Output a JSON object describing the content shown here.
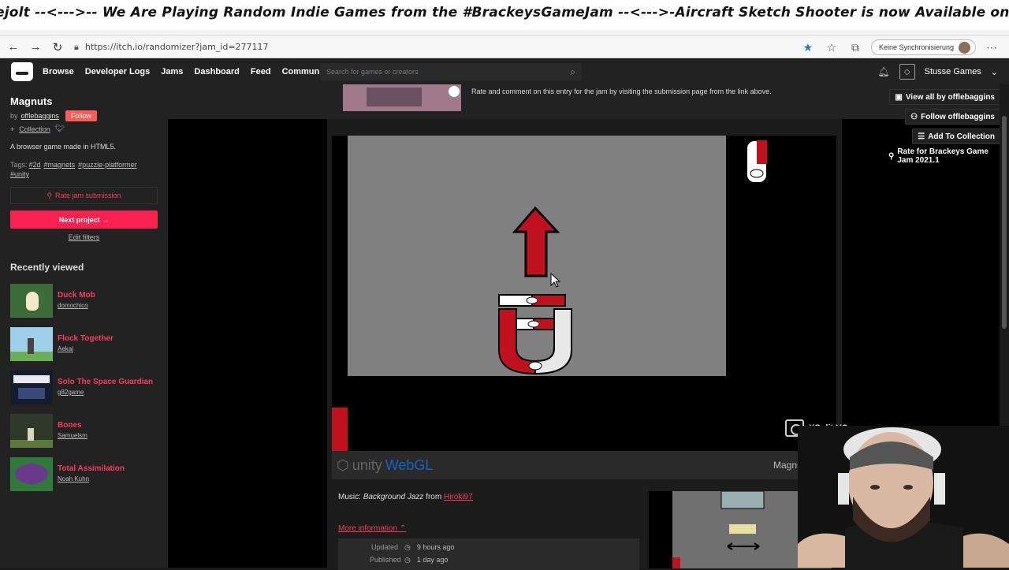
{
  "banner": {
    "text": "ejolt --<--->-- We Are Playing Random Indie Games from the #BrackeysGameJam  --<--->-Aircraft Sketch Shooter is now Available on Steam, Itchio and Game"
  },
  "browser": {
    "url": "https://itch.io/randomizer?jam_id=277117",
    "sync_label": "Keine Synchronisierung"
  },
  "header": {
    "nav": [
      "Browse",
      "Developer Logs",
      "Jams",
      "Dashboard",
      "Feed",
      "Community"
    ],
    "search_placeholder": "Search for games or creators",
    "user_name": "Stusse Games"
  },
  "sidebar": {
    "title": "Magnuts",
    "by": "by",
    "author": "offlebaggins",
    "follow": "Follow",
    "collection": "Collection",
    "description": "A browser game made in HTML5.",
    "tags_label": "Tags:",
    "tags": [
      "#2d",
      "#magnets",
      "#puzzle-platformer",
      "#unity"
    ],
    "rate_btn": "Rate jam submission",
    "next_btn": "Next project →",
    "edit_filters": "Edit filters",
    "recent_title": "Recently viewed",
    "recent": [
      {
        "name": "Duck Mob",
        "author": "domochico"
      },
      {
        "name": "Flock Together",
        "author": "Aekai"
      },
      {
        "name": "Solo The Space Guardian",
        "author": "g82game"
      },
      {
        "name": "Bones",
        "author": "Samuelsm"
      },
      {
        "name": "Total Assimilation",
        "author": "Noah Kuhn"
      }
    ]
  },
  "main": {
    "rate_note": "Rate and comment on this entry for the jam by visiting the submission page from the link above.",
    "view_all": "View all by offlebaggins",
    "follow_author": "Follow offlebaggins",
    "add_collection": "Add To Collection",
    "rate_for": "Rate for Brackeys Game Jam 2021.1",
    "unity_label": "unity",
    "webgl_label": "WebGL",
    "game_title": "Magnuts",
    "music_prefix": "Music:",
    "music_track": "Background Jazz",
    "music_from": "from",
    "music_artist": "Hiroki97",
    "more_info": "More information",
    "info": [
      {
        "key": "Updated",
        "value": "9 hours ago"
      },
      {
        "key": "Published",
        "value": "1 day ago"
      }
    ]
  },
  "overlay": {
    "xsplit": "XSplit VCam"
  },
  "colors": {
    "accent": "#fa5c5c",
    "itch_bg": "#222222",
    "webgl_blue": "#1565c0",
    "fullscreen_blue": "#22a0e0",
    "magnet_red": "#d0162a"
  }
}
